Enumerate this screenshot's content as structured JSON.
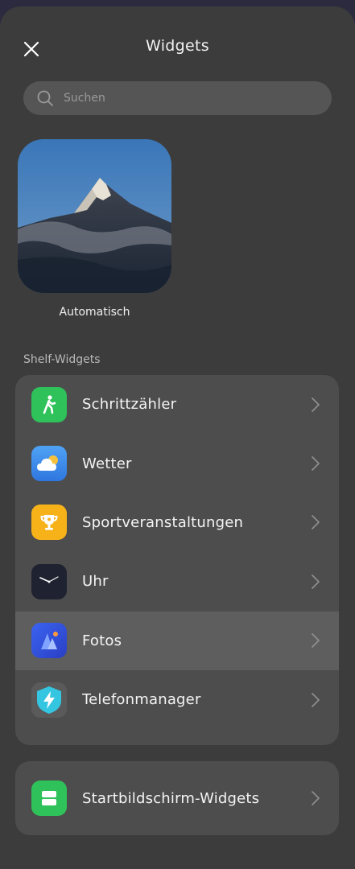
{
  "header": {
    "title": "Widgets"
  },
  "search": {
    "placeholder": "Suchen"
  },
  "featured": {
    "label": "Automatisch"
  },
  "shelf": {
    "section_title": "Shelf-Widgets",
    "items": [
      {
        "label": "Schrittzähler",
        "icon": "pedometer-icon",
        "color": "#2fc25a"
      },
      {
        "label": "Wetter",
        "icon": "weather-icon",
        "color": "#3f8fe8"
      },
      {
        "label": "Sportveranstaltungen",
        "icon": "trophy-icon",
        "color": "#f7b21a"
      },
      {
        "label": "Uhr",
        "icon": "clock-icon",
        "color": "#1f2230"
      },
      {
        "label": "Fotos",
        "icon": "photos-icon",
        "color": "#2f5ee6"
      },
      {
        "label": "Telefonmanager",
        "icon": "shield-icon",
        "color": "#34c5e0"
      }
    ]
  },
  "home": {
    "label": "Startbildschirm-Widgets",
    "icon": "home-widgets-icon",
    "color": "#2fc25a"
  }
}
